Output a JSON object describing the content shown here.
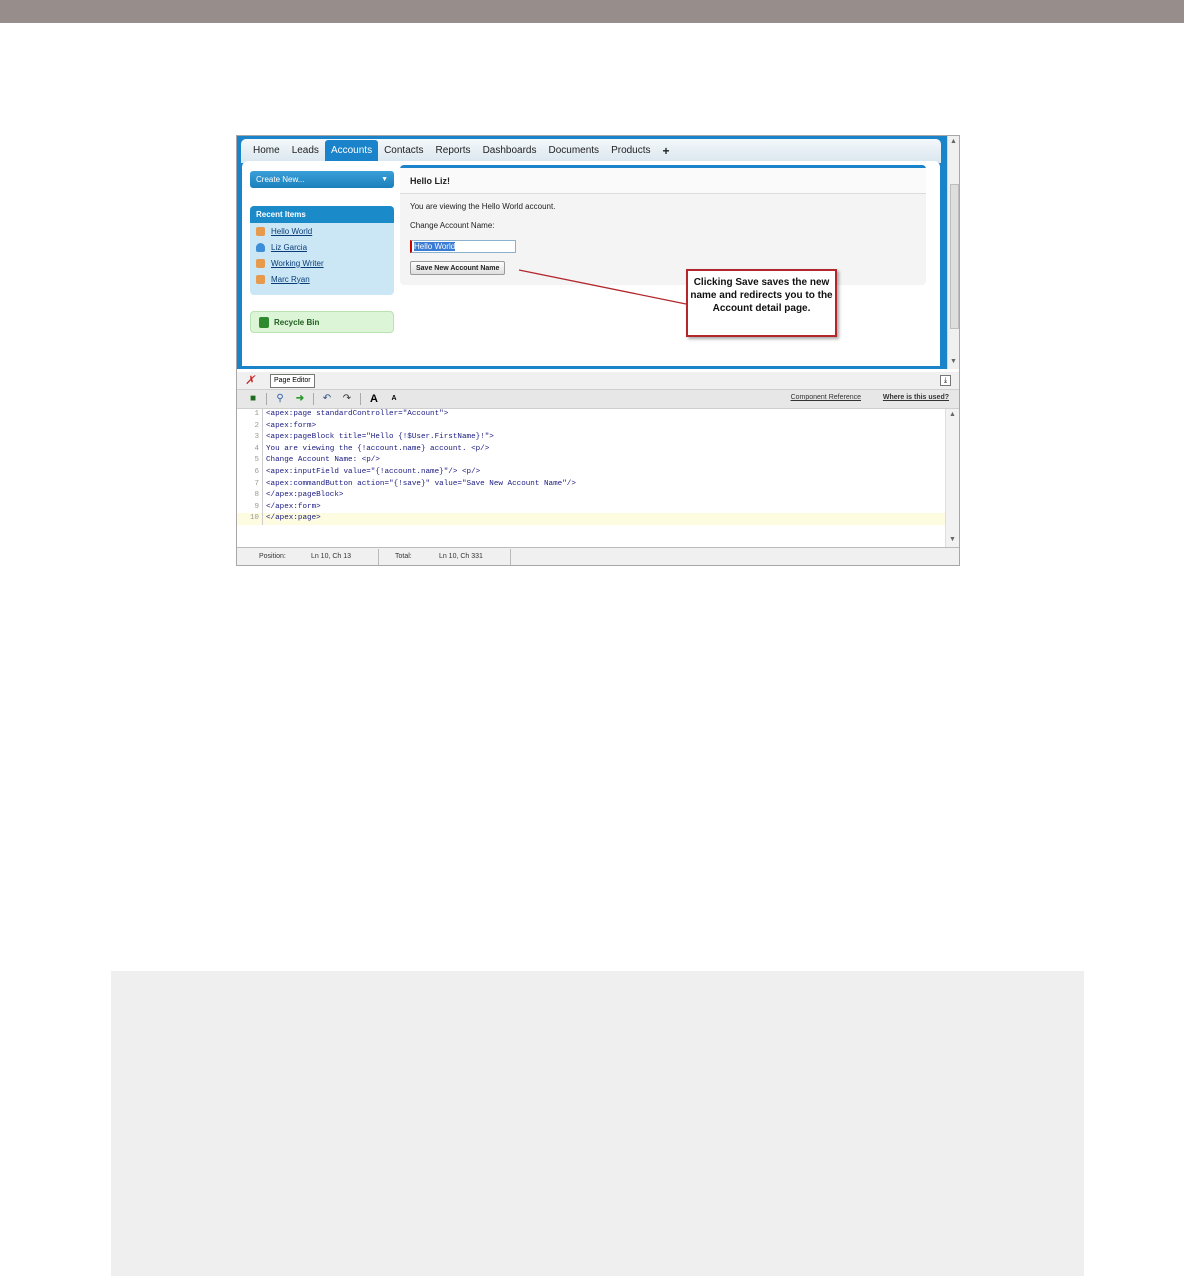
{
  "tabs": [
    "Home",
    "Leads",
    "Accounts",
    "Contacts",
    "Reports",
    "Dashboards",
    "Documents",
    "Products",
    "+"
  ],
  "active_tab": "Accounts",
  "sidebar": {
    "create_new": "Create New...",
    "recent_title": "Recent Items",
    "recent_items": [
      {
        "label": "Hello World",
        "icon": "account-icon"
      },
      {
        "label": "Liz Garcia",
        "icon": "contact-icon"
      },
      {
        "label": "Working Writer",
        "icon": "account-icon"
      },
      {
        "label": "Marc Ryan",
        "icon": "account-icon"
      }
    ],
    "recycle_bin": "Recycle Bin"
  },
  "page_block": {
    "title": "Hello Liz!",
    "viewing_text": "You are viewing the Hello World account.",
    "change_label": "Change Account Name:",
    "input_value": "Hello World",
    "save_button": "Save New Account Name"
  },
  "callout": {
    "text": "Clicking Save saves the new name and redirects you to the Account detail page."
  },
  "editor": {
    "tab_label": "Page Editor",
    "component_reference": "Component Reference",
    "where_used": "Where is this used?",
    "lines": [
      "<apex:page standardController=\"Account\">",
      "<apex:form>",
      "<apex:pageBlock title=\"Hello {!$User.FirstName}!\">",
      "You are viewing the {!account.name} account. <p/>",
      "Change Account Name: <p/>",
      "<apex:inputField value=\"{!account.name}\"/> <p/>",
      "<apex:commandButton action=\"{!save}\" value=\"Save New Account Name\"/>",
      "</apex:pageBlock>",
      "</apex:form>",
      "</apex:page>"
    ],
    "current_line": 10
  },
  "status": {
    "position_label": "Position:",
    "position_value": "Ln 10, Ch 13",
    "total_label": "Total:",
    "total_value": "Ln 10, Ch 331"
  },
  "colors": {
    "accent": "#1b83c9",
    "callout_border": "#b3262b"
  }
}
